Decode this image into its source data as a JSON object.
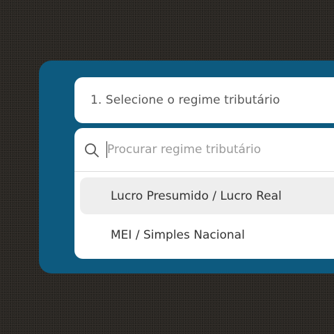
{
  "form": {
    "step_label": "1. Selecione o regime tributário"
  },
  "dropdown": {
    "search": {
      "placeholder": "Procurar regime tributário",
      "value": "",
      "icon": "search-icon"
    },
    "options": [
      {
        "label": "Lucro Presumido / Lucro Real",
        "highlighted": true
      },
      {
        "label": "MEI / Simples Nacional",
        "highlighted": false
      }
    ]
  },
  "colors": {
    "background": "#2a2723",
    "panel": "#0d5a7f",
    "card": "#ffffff",
    "highlight": "#eeeeee"
  }
}
